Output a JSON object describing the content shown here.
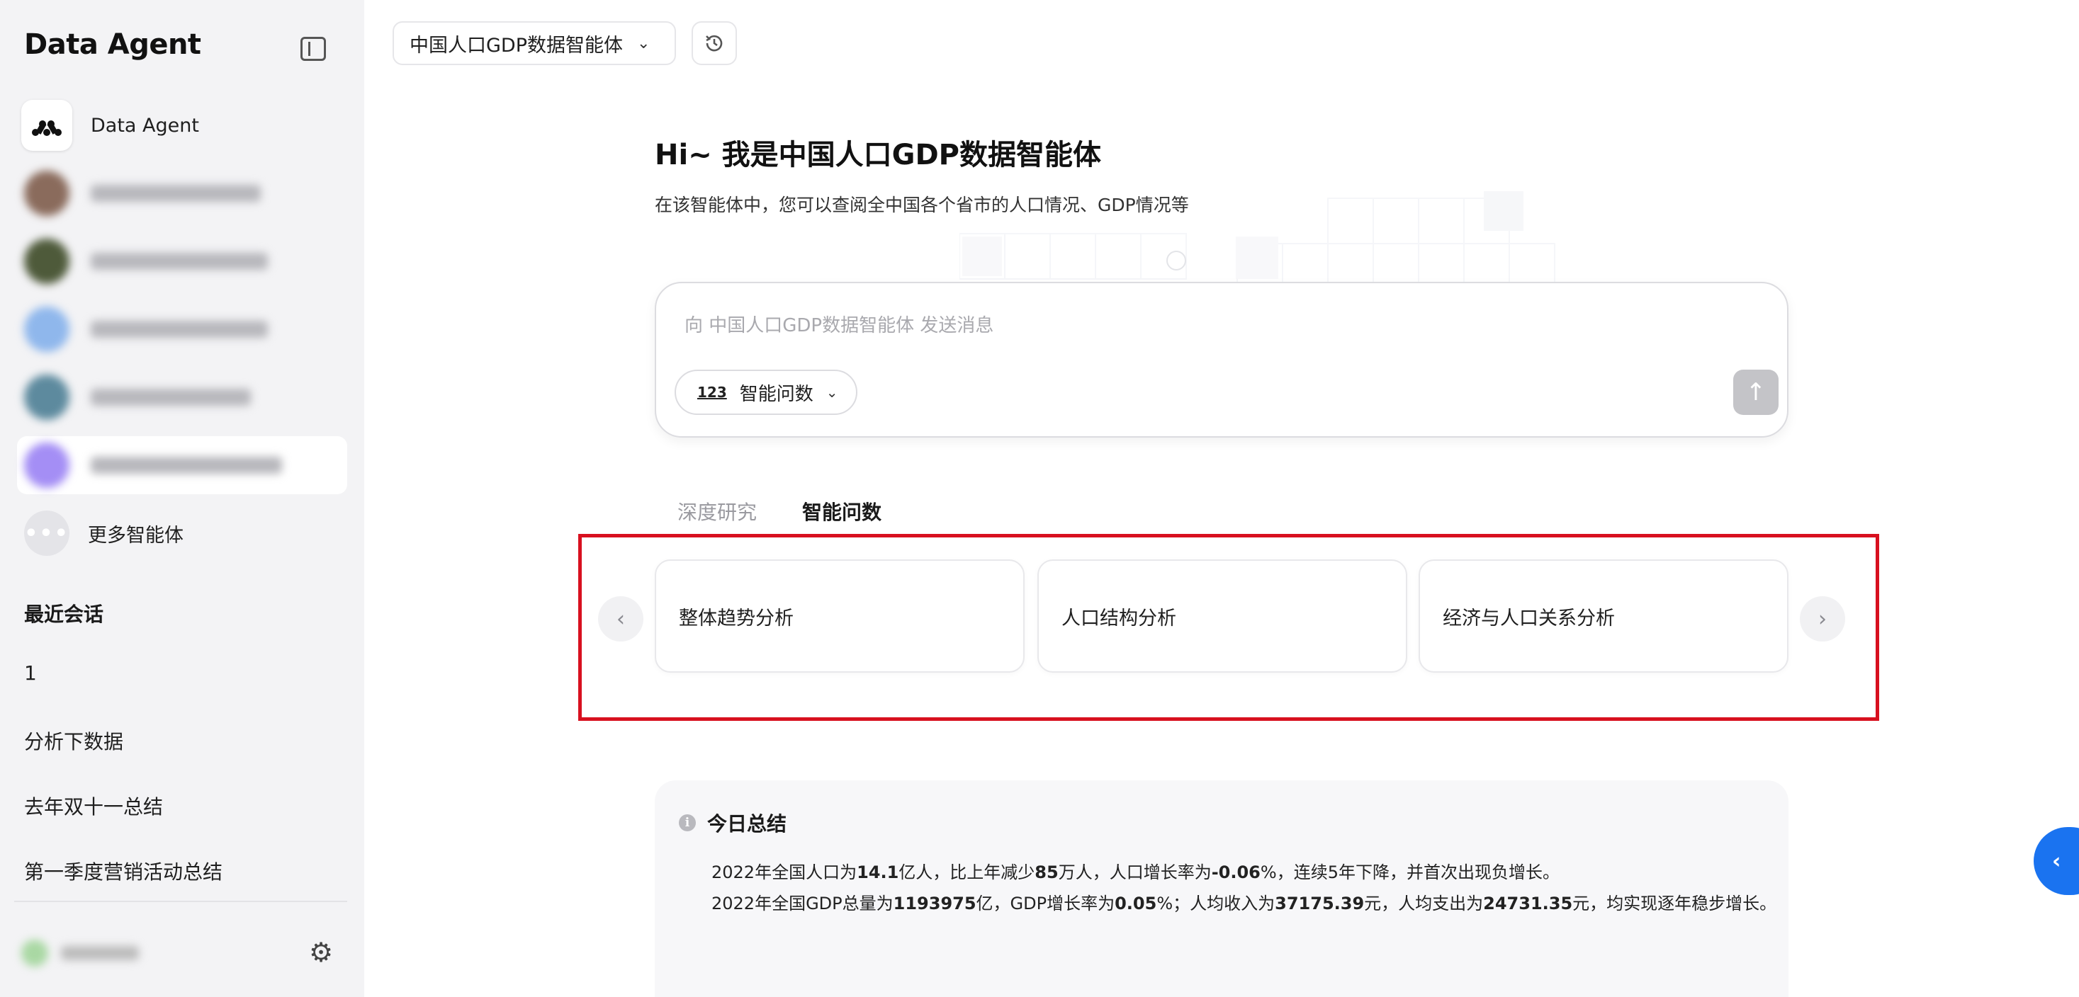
{
  "sidebar": {
    "brand": "Data Agent",
    "main_agent": "Data Agent",
    "more_agents": "更多智能体",
    "more_dots": "•••",
    "recent_title": "最近会话",
    "recent_items": [
      "1",
      "分析下数据",
      "去年双十一总结",
      "第一季度营销活动总结"
    ]
  },
  "header": {
    "agent_name": "中国人口GDP数据智能体",
    "dropdown_glyph": "⌄"
  },
  "hero": {
    "greeting": "Hi~ 我是中国人口GDP数据智能体",
    "subtitle": "在该智能体中，您可以查阅全中国各个省市的人口情况、GDP情况等"
  },
  "chat": {
    "placeholder": "向 中国人口GDP数据智能体 发送消息",
    "mode_icon": "123",
    "mode_label": "智能问数",
    "send_glyph": "↑"
  },
  "tabs": [
    {
      "label": "深度研究",
      "active": false
    },
    {
      "label": "智能问数",
      "active": true
    }
  ],
  "carousel": {
    "prev_glyph": "‹",
    "next_glyph": "›",
    "cards": [
      "整体趋势分析",
      "人口结构分析",
      "经济与人口关系分析"
    ]
  },
  "summary": {
    "info_glyph": "i",
    "title": "今日总结",
    "line1": {
      "p1": "2022年全国人口为",
      "v1": "14.1",
      "p2": "亿人，比上年减少",
      "v2": "85",
      "p3": "万人，人口增长率为",
      "v3": "-0.06",
      "p4": "%，连续5年下降，并首次出现负增长。"
    },
    "line2": {
      "p1": "2022年全国GDP总量为",
      "v1": "1193975",
      "p2": "亿，GDP增长率为",
      "v2": "0.05",
      "p3": "%；人均收入为",
      "v3": "37175.39",
      "p4": "元，人均支出为",
      "v4": "24731.35",
      "p5": "元，均实现逐年稳步增长。"
    }
  },
  "side_toggle_glyph": "‹",
  "colors": {
    "highlight_border": "#d8101f",
    "toggle_blue": "#1a73f0",
    "sidebar_bg": "#f3f3f5"
  }
}
